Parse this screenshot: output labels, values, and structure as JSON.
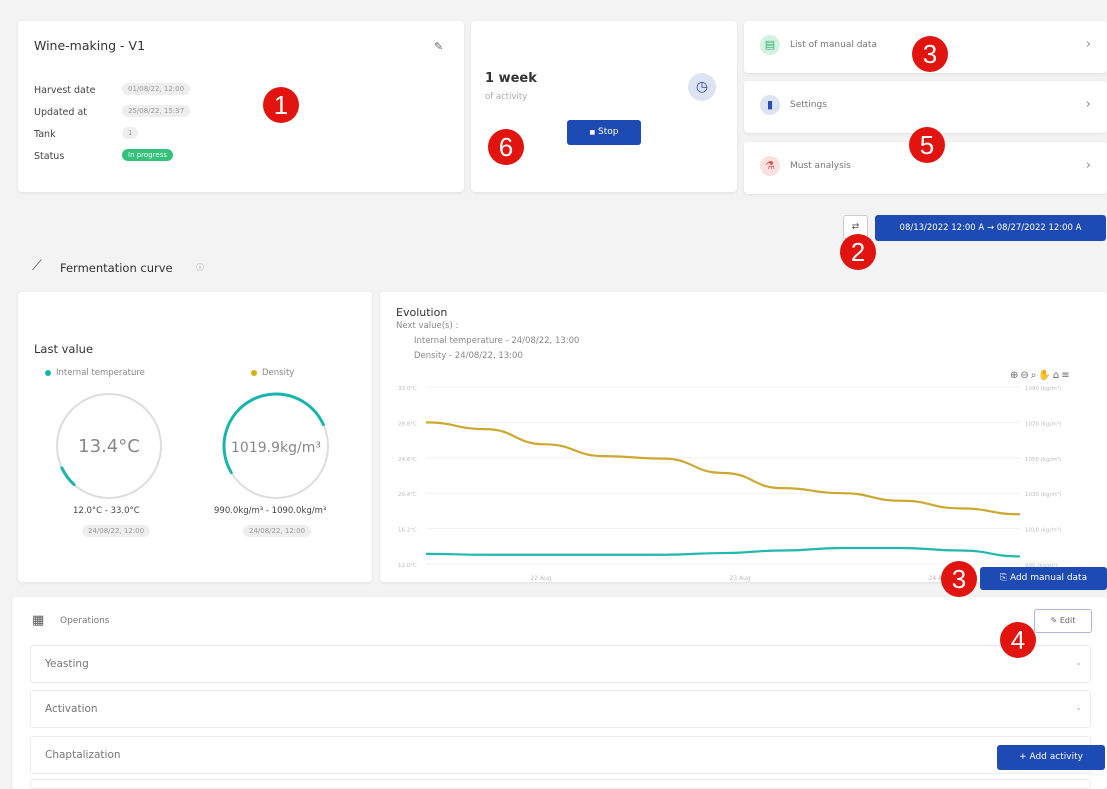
{
  "summary": {
    "title": "Wine-making - V1",
    "rows": [
      {
        "label": "Harvest date",
        "value": "01/08/22, 12:00"
      },
      {
        "label": "Updated at",
        "value": "25/08/22, 15:37"
      },
      {
        "label": "Tank",
        "value": "1"
      },
      {
        "label": "Status",
        "value": "In progress"
      }
    ]
  },
  "activity": {
    "duration": "1 week",
    "subtitle": "of activity",
    "stop_label": "Stop"
  },
  "nav": [
    {
      "label": "List of manual data",
      "icon": "database-icon"
    },
    {
      "label": "Settings",
      "icon": "book-icon"
    },
    {
      "label": "Must analysis",
      "icon": "flask-icon"
    }
  ],
  "date_range": "08/13/2022 12:00 A → 08/27/2022 12:00 A",
  "section_title": "Fermentation curve",
  "last_value": {
    "title": "Last value",
    "gauges": [
      {
        "legend": "Internal temperature",
        "value": "13.4°C",
        "range": "12.0°C - 33.0°C",
        "date": "24/08/22, 12:00",
        "color": "#1ab5aa",
        "fraction": 0.07
      },
      {
        "legend": "Density",
        "value": "1019.9kg/m³",
        "range": "990.0kg/m³ - 1090.0kg/m³",
        "date": "24/08/22, 12:00",
        "color": "#1ab5aa",
        "fraction": 0.3
      }
    ]
  },
  "evolution": {
    "title": "Evolution",
    "next_label": "Next value(s) :",
    "next_items": [
      "Internal temperature - 24/08/22, 13:00",
      "Density - 24/08/22, 13:00"
    ],
    "add_manual_label": "Add manual data"
  },
  "chart_data": {
    "type": "line",
    "left_ticks": [
      "33.0°C",
      "28.8°C",
      "24.6°C",
      "20.4°C",
      "16.2°C",
      "12.0°C"
    ],
    "right_ticks": [
      "1090 (kg/m³)",
      "1070 (kg/m³)",
      "1050 (kg/m³)",
      "1030 (kg/m³)",
      "1010 (kg/m³)",
      "990 (kg/m³)"
    ],
    "x_ticks": [
      "22 Aug",
      "23 Aug",
      "24 Aug"
    ],
    "series": [
      {
        "name": "Internal temperature",
        "color": "#21b8ad",
        "axis": "left",
        "x": [
          0,
          0.1,
          0.2,
          0.3,
          0.4,
          0.5,
          0.6,
          0.7,
          0.8,
          0.9,
          1.0
        ],
        "values": [
          13.2,
          13.1,
          13.1,
          13.1,
          13.1,
          13.3,
          13.6,
          13.9,
          13.9,
          13.6,
          12.9
        ]
      },
      {
        "name": "Density",
        "color": "#cda830",
        "axis": "left",
        "x": [
          0,
          0.1,
          0.2,
          0.3,
          0.4,
          0.5,
          0.6,
          0.7,
          0.8,
          0.9,
          1.0
        ],
        "values": [
          28.8,
          28.0,
          26.2,
          24.8,
          24.5,
          22.8,
          21.0,
          20.4,
          19.5,
          18.6,
          17.9
        ]
      }
    ]
  },
  "operations": {
    "title": "Operations",
    "edit_label": "Edit",
    "items": [
      "Yeasting",
      "Activation",
      "Chaptalization"
    ],
    "add_activity_label": "+ Add activity"
  },
  "markers": [
    "1",
    "2",
    "3",
    "3",
    "4",
    "5",
    "6"
  ]
}
